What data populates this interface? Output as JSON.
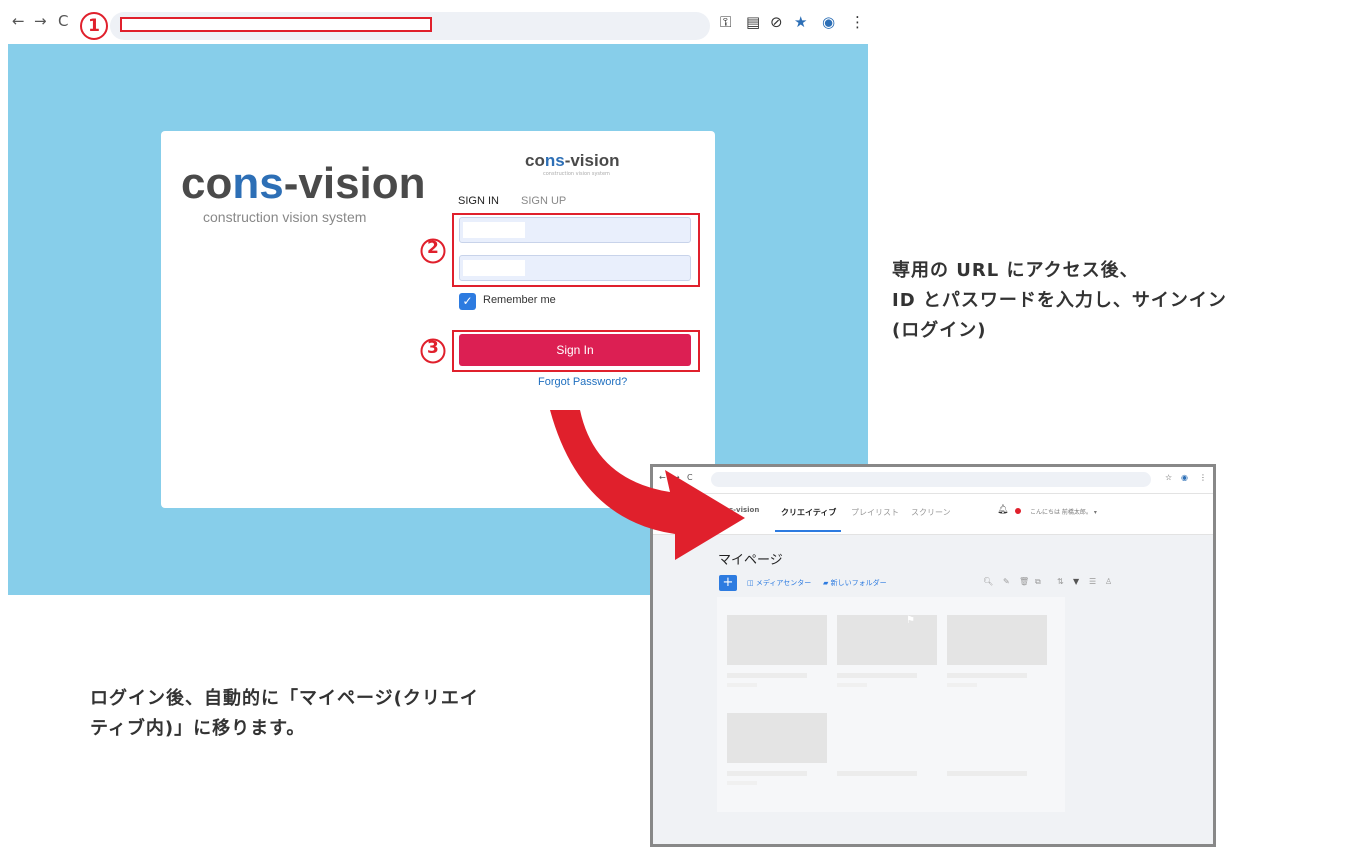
{
  "callouts": {
    "n1": "1",
    "n2": "2",
    "n3": "3"
  },
  "browser1": {
    "nav": {
      "back": "←",
      "forward": "→",
      "reload": "C"
    },
    "login": {
      "logo_a": "co",
      "logo_ns": "ns",
      "logo_b": "-vision",
      "logo_sub": "construction vision system",
      "small_logo_a": "co",
      "small_logo_ns": "ns",
      "small_logo_b": "-vision",
      "small_logo_sub": "construction vision system",
      "tab_signin": "SIGN IN",
      "tab_signup": "SIGN UP",
      "remember_label": "Remember me",
      "signin_button": "Sign In",
      "forgot_link": "Forgot Password?"
    }
  },
  "notes": {
    "note1_line1": "専用の URL にアクセス後、",
    "note1_line2": "ID とパスワードを入力し、サインイン",
    "note1_line3": "(ログイン)",
    "note2_line1": "ログイン後、自動的に「マイページ(クリエイ",
    "note2_line2": "ティブ内)」に移ります。"
  },
  "browser2": {
    "nav": {
      "back": "←",
      "forward": "→",
      "reload": "C"
    },
    "logo": "cons-vision",
    "tabs": [
      "クリエイティブ",
      "プレイリスト",
      "スクリーン"
    ],
    "greeting": "こんにちは 前橋太郎。 ▾",
    "page_title": "マイページ",
    "add_label": "+",
    "media_center": "メディアセンター",
    "new_folder": "新しいフォルダー"
  },
  "colors": {
    "accent_blue": "#2d7be0",
    "sign_in_red": "#dc1f53",
    "callout_red": "#e0202c",
    "login_bg": "#87ceea"
  }
}
